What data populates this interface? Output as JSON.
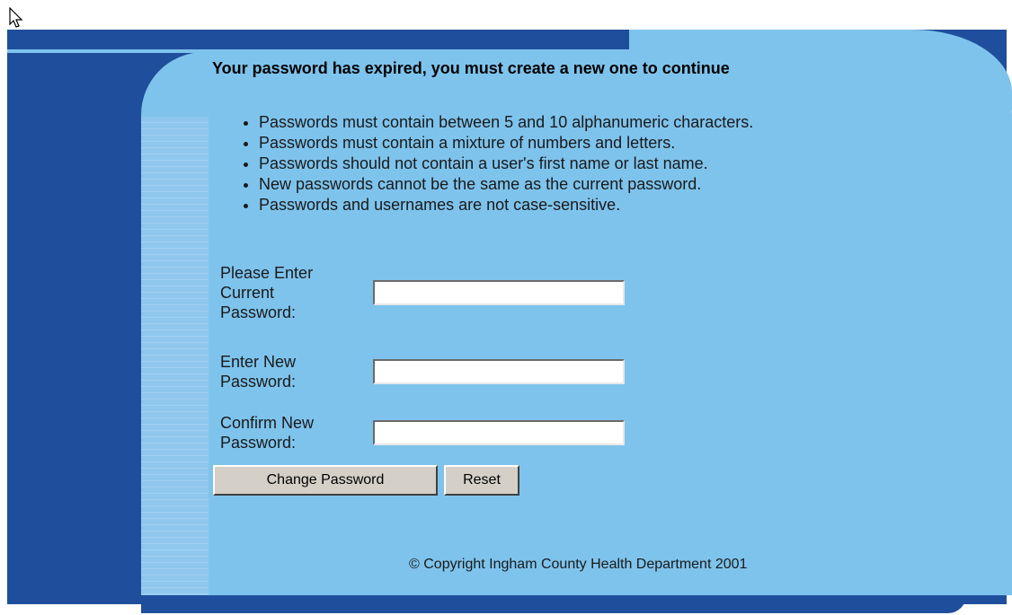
{
  "page": {
    "title": "Your password has expired, you must create a new one to continue",
    "rules": [
      "Passwords must contain between 5 and 10 alphanumeric characters.",
      "Passwords must contain a mixture of numbers and letters.",
      "Passwords should not contain a user's first name or last name.",
      "New passwords cannot be the same as the current password.",
      "Passwords and usernames are not case-sensitive."
    ]
  },
  "form": {
    "current_password": {
      "label_lines": [
        "Please Enter",
        "Current",
        "Password:"
      ],
      "value": ""
    },
    "new_password": {
      "label_lines": [
        "Enter New",
        "Password:"
      ],
      "value": ""
    },
    "confirm_password": {
      "label_lines": [
        "Confirm New",
        "Password:"
      ],
      "value": ""
    },
    "submit_label": "Change Password",
    "reset_label": "Reset"
  },
  "footer": {
    "copyright": "© Copyright Ingham County Health Department 2001"
  },
  "colors": {
    "frame_dark": "#1f4f9c",
    "panel_light": "#7ec3ec",
    "button_face": "#d4d0c8"
  },
  "icons": {
    "cursor": "mouse-pointer-icon"
  }
}
